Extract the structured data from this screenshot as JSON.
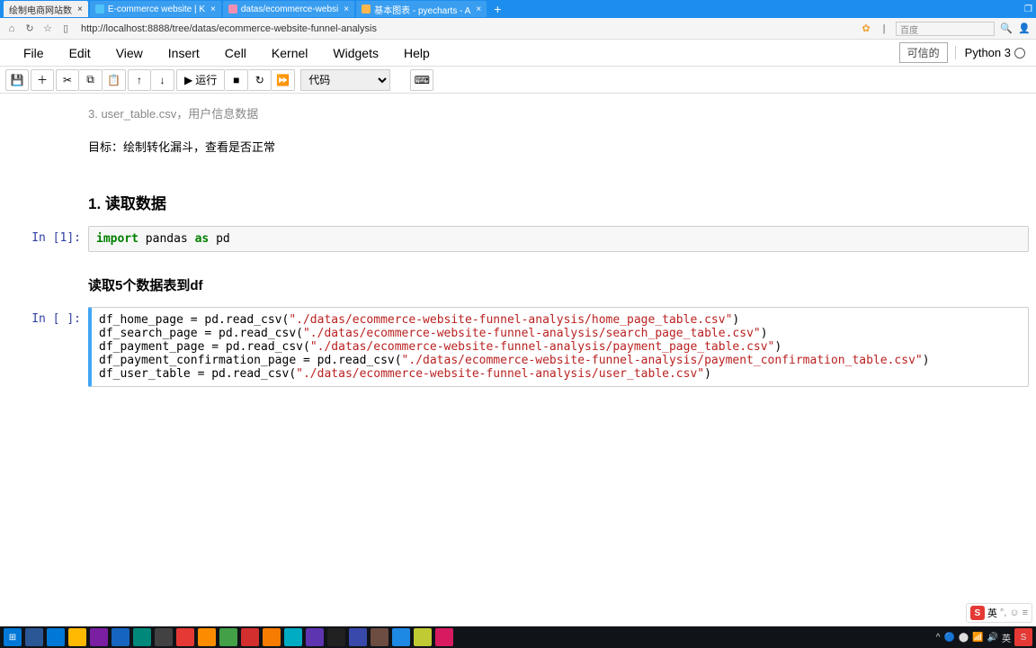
{
  "browser": {
    "tabs": [
      {
        "label": "绘制电商网站数",
        "active": true
      },
      {
        "label": "E-commerce website | K",
        "active": false
      },
      {
        "label": "datas/ecommerce-websi",
        "active": false
      },
      {
        "label": "基本图表 - pyecharts - A",
        "active": false
      }
    ],
    "url": "http://localhost:8888/tree/datas/ecommerce-website-funnel-analysis",
    "search_placeholder": "百度"
  },
  "jupyter": {
    "menu": [
      "File",
      "Edit",
      "View",
      "Insert",
      "Cell",
      "Kernel",
      "Widgets",
      "Help"
    ],
    "trusted": "可信的",
    "kernel": "Python 3",
    "toolbar": {
      "run": "运行",
      "celltype": "代码"
    }
  },
  "cells": {
    "partial_text": "3. user_table.csv，用户信息数据",
    "goal": "目标：绘制转化漏斗，查看是否正常",
    "h1": "1. 读取数据",
    "cell1_prompt": "In [1]:",
    "cell1_code": {
      "import": "import",
      "pandas": " pandas ",
      "as": "as",
      "pd": " pd"
    },
    "h2": "读取5个数据表到df",
    "cell2_prompt": "In [ ]:",
    "cell2_code": {
      "l1a": "df_home_page = pd.read_csv(",
      "l1b": "\"./datas/ecommerce-website-funnel-analysis/home_page_table.csv\"",
      "l1c": ")",
      "l2a": "df_search_page = pd.read_csv(",
      "l2b": "\"./datas/ecommerce-website-funnel-analysis/search_page_table.csv\"",
      "l2c": ")",
      "l3a": "df_payment_page = pd.read_csv(",
      "l3b": "\"./datas/ecommerce-website-funnel-analysis/payment_page_table.csv\"",
      "l3c": ")",
      "l4a": "df_payment_confirmation_page = pd.read_csv(",
      "l4b": "\"./datas/ecommerce-website-funnel-analysis/payment_confirmation_table.csv\"",
      "l4c": ")",
      "l5a": "df_user_table = pd.read_csv(",
      "l5b": "\"./datas/ecommerce-website-funnel-analysis/user_table.csv\"",
      "l5c": ")"
    }
  },
  "ime": {
    "lang": "英"
  }
}
